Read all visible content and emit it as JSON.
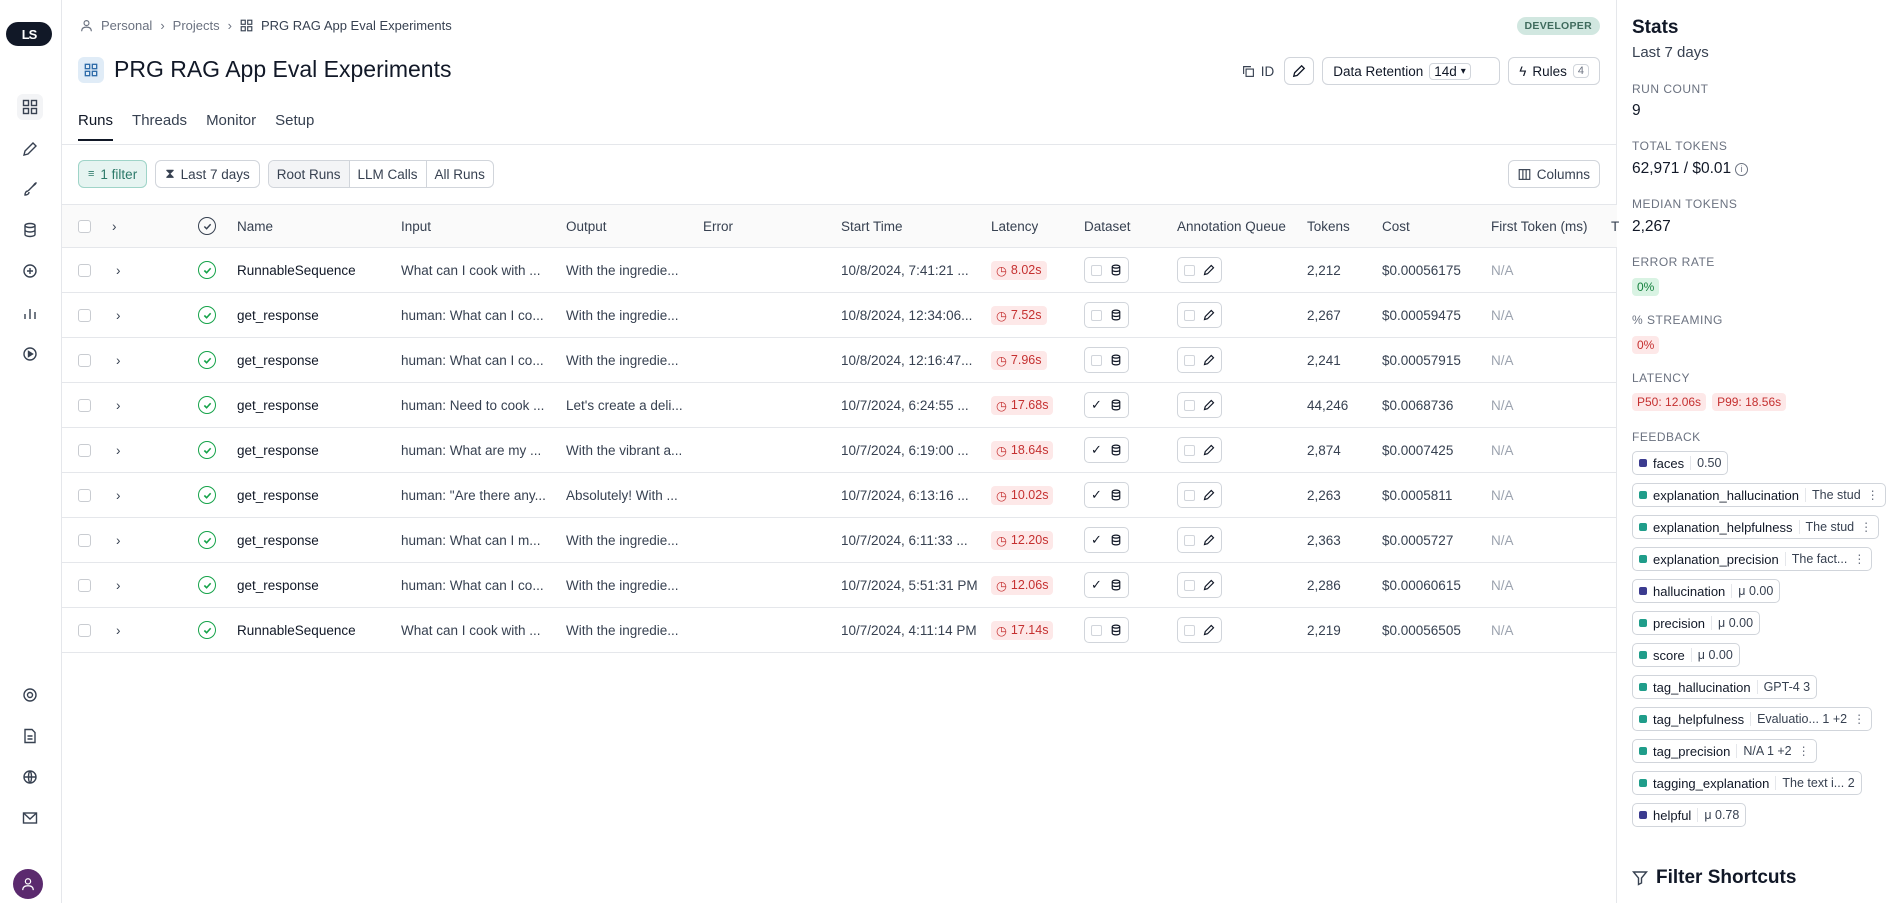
{
  "nav": {
    "logo_text": "LS"
  },
  "breadcrumb": {
    "items": [
      "Personal",
      "Projects",
      "PRG RAG App Eval Experiments"
    ]
  },
  "badge": "DEVELOPER",
  "page_title": "PRG RAG App Eval Experiments",
  "header_actions": {
    "id_label": "ID",
    "retention_label": "Data Retention",
    "retention_value": "14d",
    "rules_label": "Rules",
    "rules_count": "4"
  },
  "tabs": [
    "Runs",
    "Threads",
    "Monitor",
    "Setup"
  ],
  "filters": {
    "filter_label": "1 filter",
    "time_label": "Last 7 days",
    "segments": [
      "Root Runs",
      "LLM Calls",
      "All Runs"
    ],
    "columns_label": "Columns"
  },
  "columns": [
    "Name",
    "Input",
    "Output",
    "Error",
    "Start Time",
    "Latency",
    "Dataset",
    "Annotation Queue",
    "Tokens",
    "Cost",
    "First Token (ms)",
    "T"
  ],
  "rows": [
    {
      "name": "RunnableSequence",
      "input": "What can I cook with ...",
      "output": "With the ingredie...",
      "error": "",
      "start": "10/8/2024, 7:41:21 ...",
      "latency": "8.02s",
      "dataset": false,
      "tokens": "2,212",
      "cost": "$0.00056175",
      "first_token": "N/A"
    },
    {
      "name": "get_response",
      "input": "human: What can I co...",
      "output": "With the ingredie...",
      "error": "",
      "start": "10/8/2024, 12:34:06...",
      "latency": "7.52s",
      "dataset": false,
      "tokens": "2,267",
      "cost": "$0.00059475",
      "first_token": "N/A"
    },
    {
      "name": "get_response",
      "input": "human: What can I co...",
      "output": "With the ingredie...",
      "error": "",
      "start": "10/8/2024, 12:16:47...",
      "latency": "7.96s",
      "dataset": false,
      "tokens": "2,241",
      "cost": "$0.00057915",
      "first_token": "N/A"
    },
    {
      "name": "get_response",
      "input": "human: Need to cook ...",
      "output": "Let's create a deli...",
      "error": "",
      "start": "10/7/2024, 6:24:55 ...",
      "latency": "17.68s",
      "dataset": true,
      "tokens": "44,246",
      "cost": "$0.0068736",
      "first_token": "N/A"
    },
    {
      "name": "get_response",
      "input": "human: What are my ...",
      "output": "With the vibrant a...",
      "error": "",
      "start": "10/7/2024, 6:19:00 ...",
      "latency": "18.64s",
      "dataset": true,
      "tokens": "2,874",
      "cost": "$0.0007425",
      "first_token": "N/A"
    },
    {
      "name": "get_response",
      "input": "human: \"Are there any...",
      "output": "Absolutely! With ...",
      "error": "",
      "start": "10/7/2024, 6:13:16 ...",
      "latency": "10.02s",
      "dataset": true,
      "tokens": "2,263",
      "cost": "$0.0005811",
      "first_token": "N/A"
    },
    {
      "name": "get_response",
      "input": "human: What can I m...",
      "output": "With the ingredie...",
      "error": "",
      "start": "10/7/2024, 6:11:33 ...",
      "latency": "12.20s",
      "dataset": true,
      "tokens": "2,363",
      "cost": "$0.0005727",
      "first_token": "N/A"
    },
    {
      "name": "get_response",
      "input": "human: What can I co...",
      "output": "With the ingredie...",
      "error": "",
      "start": "10/7/2024, 5:51:31 PM",
      "latency": "12.06s",
      "dataset": true,
      "tokens": "2,286",
      "cost": "$0.00060615",
      "first_token": "N/A"
    },
    {
      "name": "RunnableSequence",
      "input": "What can I cook with ...",
      "output": "With the ingredie...",
      "error": "",
      "start": "10/7/2024, 4:11:14 PM",
      "latency": "17.14s",
      "dataset": false,
      "tokens": "2,219",
      "cost": "$0.00056505",
      "first_token": "N/A"
    }
  ],
  "stats": {
    "title": "Stats",
    "period": "Last 7 days",
    "run_count_label": "RUN COUNT",
    "run_count": "9",
    "total_tokens_label": "TOTAL TOKENS",
    "total_tokens": "62,971 / $0.01",
    "median_tokens_label": "MEDIAN TOKENS",
    "median_tokens": "2,267",
    "error_rate_label": "ERROR RATE",
    "error_rate": "0%",
    "streaming_label": "% STREAMING",
    "streaming": "0%",
    "latency_label": "LATENCY",
    "p50": "P50: 12.06s",
    "p99": "P99: 18.56s",
    "feedback_label": "FEEDBACK",
    "feedback": [
      {
        "name": "faces",
        "value": "0.50",
        "color": "#3b3b8f",
        "more": false
      },
      {
        "name": "explanation_hallucination",
        "value": "The stud",
        "color": "#1f9d8a",
        "more": true
      },
      {
        "name": "explanation_helpfulness",
        "value": "The stud",
        "color": "#1f9d8a",
        "more": true
      },
      {
        "name": "explanation_precision",
        "value": "The fact...",
        "color": "#1f9d8a",
        "more": true
      },
      {
        "name": "hallucination",
        "value": "μ 0.00",
        "color": "#3b3b8f",
        "more": false
      },
      {
        "name": "precision",
        "value": "μ 0.00",
        "color": "#1f9d8a",
        "more": false
      },
      {
        "name": "score",
        "value": "μ 0.00",
        "color": "#1f9d8a",
        "more": false
      },
      {
        "name": "tag_hallucination",
        "value": "GPT-4 3",
        "color": "#1f9d8a",
        "more": false
      },
      {
        "name": "tag_helpfulness",
        "value": "Evaluatio... 1   +2",
        "color": "#1f9d8a",
        "more": true
      },
      {
        "name": "tag_precision",
        "value": "N/A 1   +2",
        "color": "#1f9d8a",
        "more": true
      },
      {
        "name": "tagging_explanation",
        "value": "The text i... 2",
        "color": "#1f9d8a",
        "more": false
      },
      {
        "name": "helpful",
        "value": "μ 0.78",
        "color": "#3b3b8f",
        "more": false
      }
    ],
    "filter_shortcuts": "Filter Shortcuts"
  }
}
